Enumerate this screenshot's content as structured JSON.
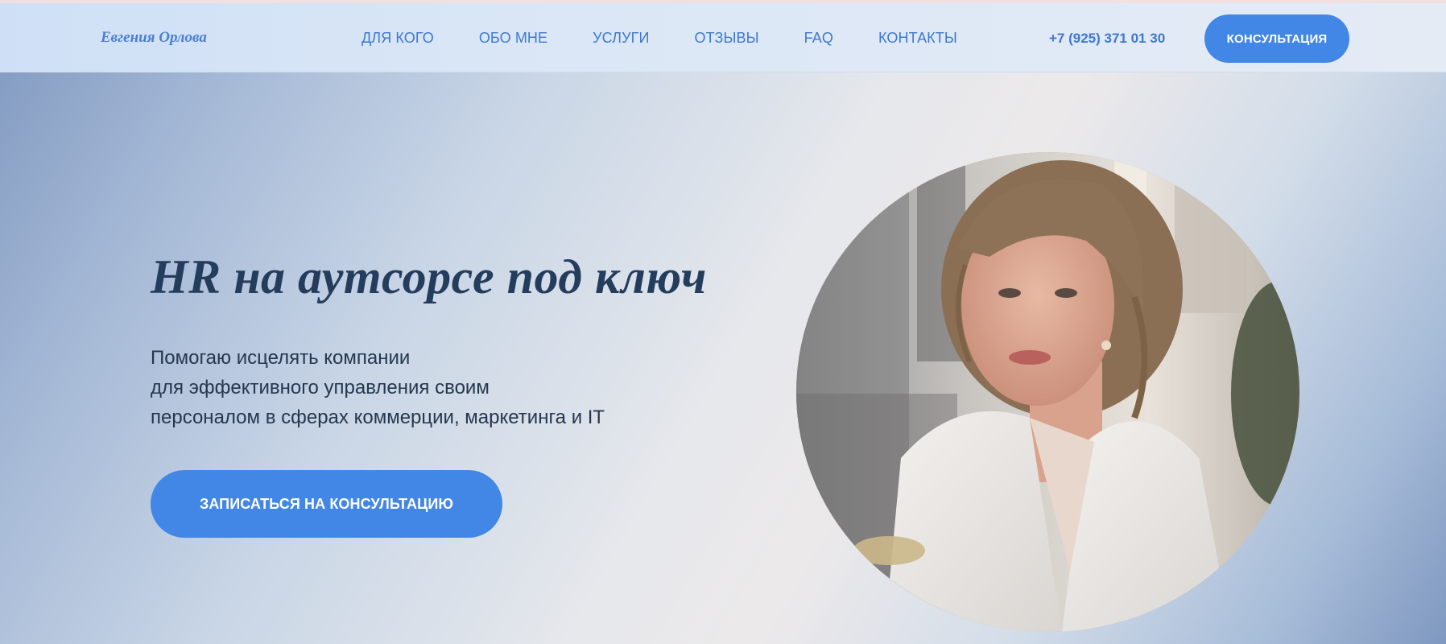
{
  "header": {
    "logo": "Евгения Орлова",
    "nav": [
      {
        "label": "ДЛЯ КОГО"
      },
      {
        "label": "ОБО МНЕ"
      },
      {
        "label": "УСЛУГИ"
      },
      {
        "label": "ОТЗЫВЫ"
      },
      {
        "label": "FAQ"
      },
      {
        "label": "КОНТАКТЫ"
      }
    ],
    "phone": "+7 (925) 371 01 30",
    "cta_label": "КОНСУЛЬТАЦИЯ"
  },
  "hero": {
    "title": "HR на аутсорсе под ключ",
    "subtitle_lines": [
      "Помогаю исцелять компании",
      "для эффективного управления своим",
      "персоналом в сферах коммерции, маркетинга и IT"
    ],
    "cta_label": "ЗАПИСАТЬСЯ НА КОНСУЛЬТАЦИЮ"
  },
  "colors": {
    "accent": "#4287e6",
    "nav_text": "#3f78cf",
    "heading": "#243d5c"
  },
  "icons": {
    "portrait": "woman-portrait-photo"
  }
}
